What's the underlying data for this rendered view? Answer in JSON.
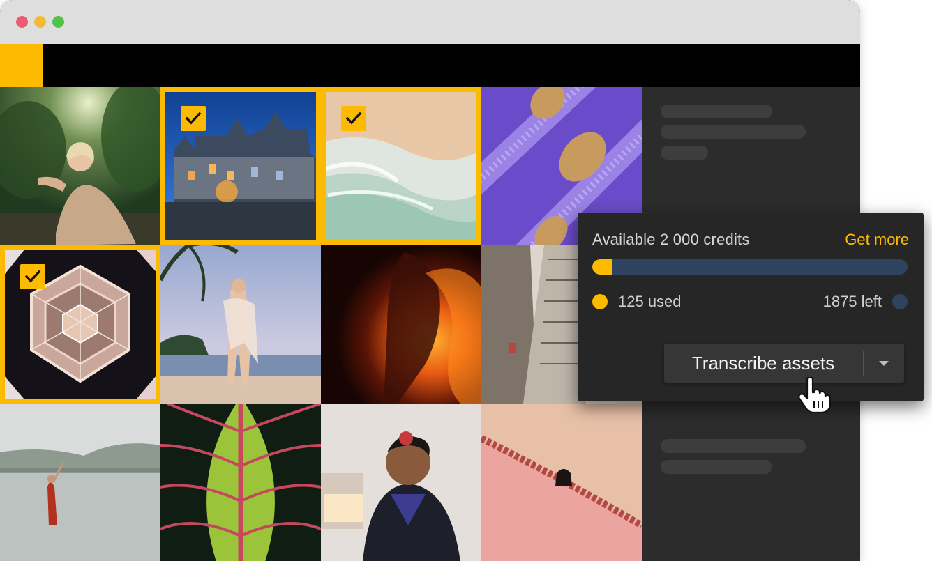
{
  "credits": {
    "title": "Available 2 000 credits",
    "get_more_label": "Get more",
    "used_label": "125 used",
    "left_label": "1875 left",
    "used_fraction": 0.0625
  },
  "actions": {
    "transcribe_label": "Transcribe assets"
  },
  "colors": {
    "accent": "#fcba00",
    "remaining": "#2f435e"
  },
  "icons": {
    "check": "checkmark-icon",
    "dropdown": "chevron-down-icon",
    "cursor": "hand-pointer-icon"
  },
  "grid": {
    "selected_count": 3
  }
}
